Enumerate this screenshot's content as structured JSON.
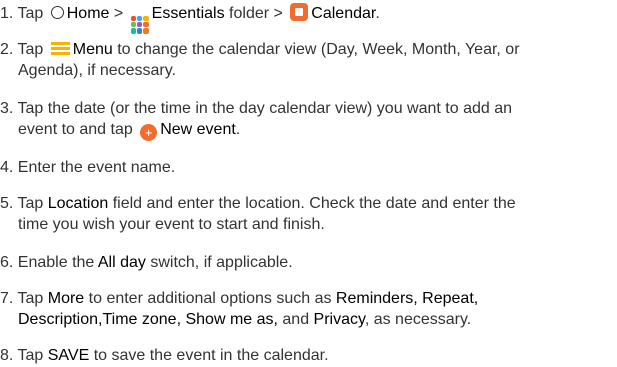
{
  "steps": [
    {
      "num": "1.",
      "t1": "Tap ",
      "home": "Home",
      "t2": " > ",
      "essentials": "Essentials",
      "t3": " folder > ",
      "calendar": "Calendar",
      "t4": "."
    },
    {
      "num": "2.",
      "t1": "Tap ",
      "menu": "Menu",
      "t2": " to change the calendar view (Day, Week, Month, Year, or",
      "line2": "Agenda), if necessary."
    },
    {
      "num": "3.",
      "line1": "Tap the date (or the time in the day calendar view) you want to add an",
      "t1": "event to and tap ",
      "new_event": "New event",
      "t2": "."
    },
    {
      "num": "4.",
      "text": "Enter the event name."
    },
    {
      "num": "5.",
      "t1": "Tap ",
      "location": "Location",
      "t2": " field and enter the location. Check the date and enter the",
      "line2": "time you wish your event to start and finish."
    },
    {
      "num": "6.",
      "t1": "Enable the ",
      "all_day": "All day",
      "t2": " switch, if applicable."
    },
    {
      "num": "7.",
      "t1": "Tap ",
      "more": "More",
      "t2": " to enter additional options such as ",
      "reminders": "Reminders, Repeat,",
      "description": "Description,Time zone, Show me as,",
      "t3": " and ",
      "privacy": "Privacy",
      "t4": ", as necessary."
    },
    {
      "num": "8.",
      "t1": "Tap ",
      "save": "SAVE",
      "t2": " to save the event in the calendar."
    }
  ],
  "icons": {
    "home": "home-circle-icon",
    "essentials": "folder-grid-icon",
    "calendar": "calendar-app-icon",
    "menu": "hamburger-menu-icon",
    "new_event": "add-plus-icon",
    "plus_glyph": "+"
  },
  "colors": {
    "text": "#333333",
    "accent_orange": "#f26b2f",
    "menu_yellow": "#f5b400"
  }
}
